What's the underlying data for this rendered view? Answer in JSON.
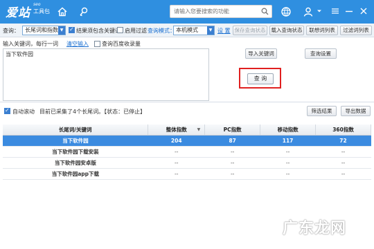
{
  "titlebar": {
    "logo_main": "爱站",
    "logo_seo": "seo",
    "logo_sub": "工具包",
    "search_placeholder": "请输入您要搜索的功能"
  },
  "options": {
    "query_label": "查询：",
    "query_type": "长尾词和指数",
    "checkbox_contains": "结果须包含关键词",
    "checkbox_contains_checked": true,
    "checkbox_filter": "启用过滤",
    "checkbox_filter_checked": false,
    "query_mode_label": "查询模式：",
    "query_mode_value": "本机模式",
    "settings_link": "设 置",
    "btn_save_state": "保存查询状态",
    "btn_load_state": "载入查询状态",
    "btn_related": "联想词列表",
    "btn_filter_list": "过滤词列表"
  },
  "input": {
    "hint": "输入关键词，每行一词",
    "clear_link": "清空输入",
    "baidu_checkbox": "查询百度收录量",
    "baidu_checked": false,
    "textarea_value": "当下软件园",
    "btn_import": "导入关键词",
    "btn_query_settings": "查询设置",
    "btn_query": "查 询"
  },
  "status": {
    "auto_scroll": "自动滚动",
    "auto_scroll_checked": true,
    "message": "目前已采集了4个长尾词。【状态：已停止】",
    "btn_filter_results": "筛选结果",
    "btn_export": "导出数据"
  },
  "table": {
    "headers": [
      "长尾词/关键词",
      "整体指数",
      "PC指数",
      "移动指数",
      "360指数"
    ],
    "rows": [
      [
        "当下软件园",
        "204",
        "87",
        "117",
        "72"
      ],
      [
        "当下软件园下载安装",
        "--",
        "--",
        "--",
        "--"
      ],
      [
        "当下软件园安卓版",
        "--",
        "--",
        "--",
        "--"
      ],
      [
        "当下软件园app下载",
        "--",
        "--",
        "--",
        "--"
      ]
    ]
  },
  "watermark": "广东龙网",
  "colors": {
    "titlebar": "#2f8fe0",
    "selected_row": "#3b8be0",
    "highlight_box": "#e02020"
  }
}
